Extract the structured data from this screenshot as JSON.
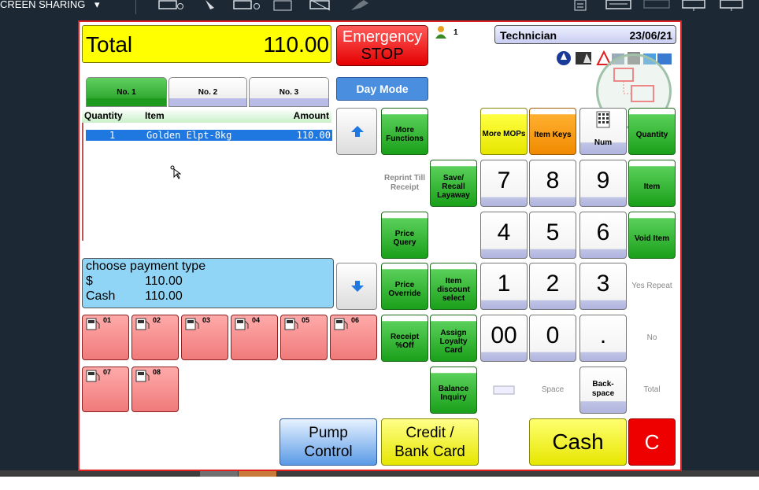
{
  "topbar": {
    "share_label": "CREEN SHARING",
    "icons": [
      "chevron-down-icon",
      "monitor-record-icon",
      "pointer-icon",
      "monitor-power-icon",
      "keyboard-shortcut-icon",
      "monitor-off-icon",
      "plug-icon",
      "document-icon",
      "keyboard-icon",
      "monitor-icon",
      "monitor-icon",
      "monitor-icon"
    ]
  },
  "header": {
    "total_label": "Total",
    "total_value": "110.00",
    "estop_line1": "Emergency",
    "estop_line2": "STOP",
    "operator_count": "1",
    "user_name": "Technician",
    "date": "23/06/21",
    "status_badge": "1"
  },
  "tabs": [
    {
      "label": "No. 1",
      "active": true
    },
    {
      "label": "No. 2",
      "active": false
    },
    {
      "label": "No. 3",
      "active": false
    }
  ],
  "day_mode_label": "Day Mode",
  "transaction": {
    "columns": [
      "Quantity",
      "Item",
      "Amount"
    ],
    "rows": [
      {
        "quantity": "1",
        "item": "Golden Elpt-8kg",
        "amount": "110.00"
      }
    ]
  },
  "payment": {
    "title": "choose payment type",
    "rows": [
      {
        "label": "$",
        "value": "110.00"
      },
      {
        "label": "Cash",
        "value": "110.00"
      }
    ]
  },
  "function_buttons": {
    "more_functions": "More Functions",
    "reprint": "Reprint Till Receipt",
    "save_recall": "Save/ Recall Layaway",
    "price_query": "Price Query",
    "price_override": "Price Override",
    "item_discount": "Item discount select",
    "receipt_off": "Receipt %Off",
    "assign_loyalty": "Assign Loyalty Card",
    "balance_inquiry": "Balance Inquiry"
  },
  "right_buttons": {
    "more_mops": "More MOPs",
    "item_keys": "Item Keys",
    "num": "Num",
    "quantity": "Quantity",
    "item": "Item",
    "void_item": "Void Item",
    "yes_repeat": "Yes Repeat",
    "no": "No",
    "space": "Space",
    "backspace": "Back- space",
    "total": "Total"
  },
  "numpad": [
    "7",
    "8",
    "9",
    "4",
    "5",
    "6",
    "1",
    "2",
    "3",
    "00",
    "0",
    "."
  ],
  "pumps": [
    "01",
    "02",
    "03",
    "04",
    "05",
    "06",
    "07",
    "08"
  ],
  "bottom_buttons": {
    "pump_control": "Pump Control",
    "credit": "Credit / Bank Card",
    "cash": "Cash",
    "clear": "C"
  },
  "colors": {
    "frame": "#e02020",
    "total_bg": "#ffff00",
    "green_button": "#1aa01a",
    "pump_bg": "#f07a7a",
    "payment_bg": "#90d5f5",
    "selected_row": "#1e78e0"
  }
}
